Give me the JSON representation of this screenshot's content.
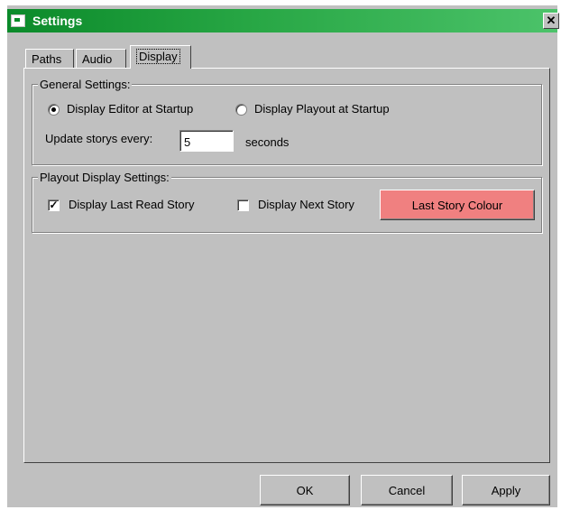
{
  "window": {
    "title": "Settings",
    "close_glyph": "✕"
  },
  "tabs": [
    {
      "label": "Paths"
    },
    {
      "label": "Audio"
    },
    {
      "label": "Display",
      "active": true
    }
  ],
  "general_settings": {
    "legend": "General Settings:",
    "radio_editor_label": "Display Editor at Startup",
    "radio_editor_checked": true,
    "radio_playout_label": "Display Playout at Startup",
    "radio_playout_checked": false,
    "update_label": "Update storys every:",
    "update_value": "5",
    "update_units": "seconds"
  },
  "playout_settings": {
    "legend": "Playout Display Settings:",
    "check_last_read_label": "Display Last Read Story",
    "check_last_read_checked": true,
    "check_next_label": "Display Next Story",
    "check_next_checked": false,
    "colour_button_label": "Last Story Colour",
    "colour_button_color": "#f08080"
  },
  "footer": {
    "ok_label": "OK",
    "cancel_label": "Cancel",
    "apply_label": "Apply"
  },
  "colors": {
    "titlebar_start": "#0b8a2a",
    "titlebar_end": "#4cc36a",
    "dialog_face": "#c0c0c0"
  }
}
